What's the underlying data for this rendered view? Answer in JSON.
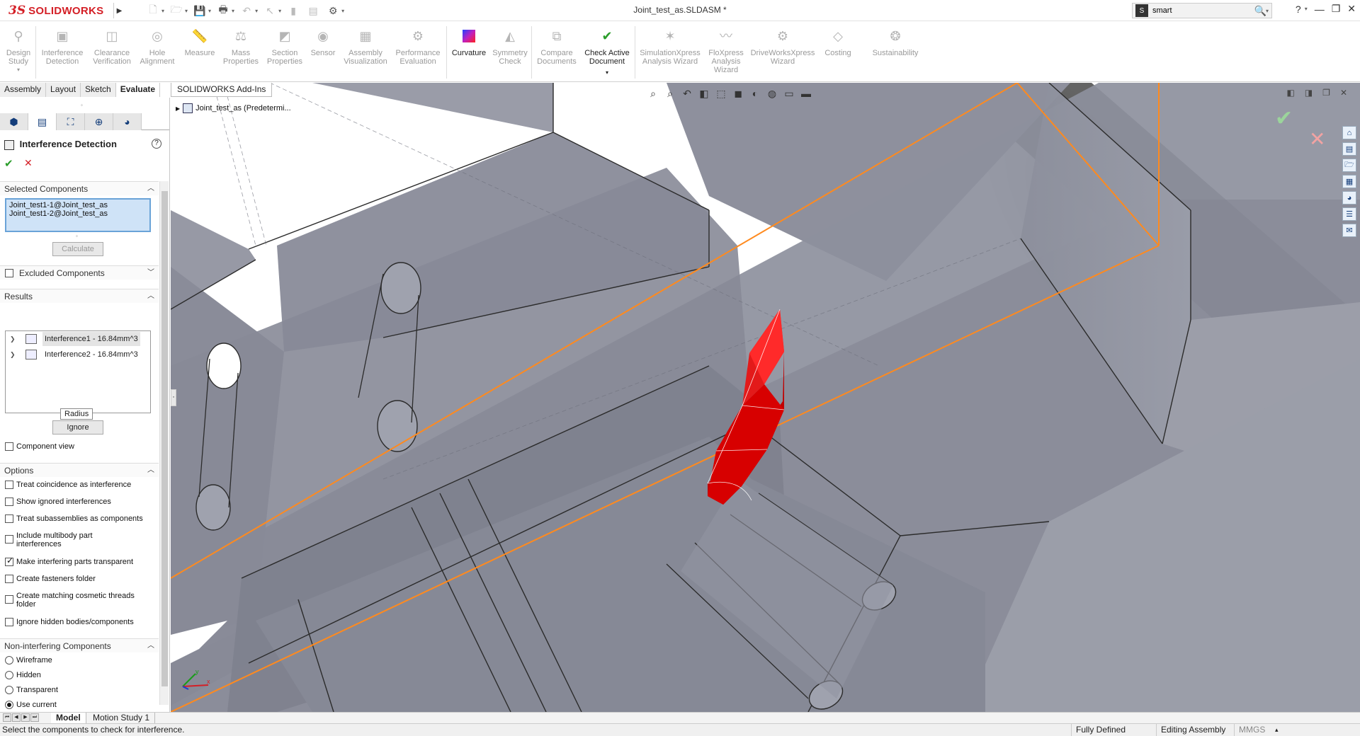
{
  "app": {
    "logo_prefix": "3S",
    "logo_text": "SOLIDWORKS",
    "document_title": "Joint_test_as.SLDASM *"
  },
  "search": {
    "value": "smart",
    "placeholder": ""
  },
  "command_manager": {
    "items": [
      {
        "label": "Design Study",
        "icon": "design-study-icon",
        "enabled": false
      },
      {
        "label": "Interference Detection",
        "icon": "interference-detection-icon",
        "enabled": false
      },
      {
        "label": "Clearance Verification",
        "icon": "clearance-verification-icon",
        "enabled": false
      },
      {
        "label": "Hole Alignment",
        "icon": "hole-alignment-icon",
        "enabled": false
      },
      {
        "label": "Measure",
        "icon": "measure-icon",
        "enabled": false
      },
      {
        "label": "Mass Properties",
        "icon": "mass-properties-icon",
        "enabled": false
      },
      {
        "label": "Section Properties",
        "icon": "section-properties-icon",
        "enabled": false
      },
      {
        "label": "Sensor",
        "icon": "sensor-icon",
        "enabled": false
      },
      {
        "label": "Assembly Visualization",
        "icon": "assembly-visualization-icon",
        "enabled": false
      },
      {
        "label": "Performance Evaluation",
        "icon": "performance-evaluation-icon",
        "enabled": false
      },
      {
        "label": "Curvature",
        "icon": "curvature-icon",
        "enabled": true
      },
      {
        "label": "Symmetry Check",
        "icon": "symmetry-check-icon",
        "enabled": false
      },
      {
        "label": "Compare Documents",
        "icon": "compare-documents-icon",
        "enabled": false
      },
      {
        "label": "Check Active Document",
        "icon": "check-active-document-icon",
        "enabled": true
      },
      {
        "label": "SimulationXpress Analysis Wizard",
        "icon": "simulationxpress-icon",
        "enabled": false
      },
      {
        "label": "FloXpress Analysis Wizard",
        "icon": "floxpress-icon",
        "enabled": false
      },
      {
        "label": "DriveWorksXpress Wizard",
        "icon": "driveworksxpress-icon",
        "enabled": false
      },
      {
        "label": "Costing",
        "icon": "costing-icon",
        "enabled": false
      },
      {
        "label": "Sustainability",
        "icon": "sustainability-icon",
        "enabled": false
      }
    ],
    "tabs": [
      "Assembly",
      "Layout",
      "Sketch",
      "Evaluate",
      "SOLIDWORKS Add-Ins"
    ],
    "active_tab": "Evaluate"
  },
  "property_manager": {
    "title": "Interference Detection",
    "selected_components": {
      "header": "Selected Components",
      "items": [
        "Joint_test1-1@Joint_test_as",
        "Joint_test1-2@Joint_test_as"
      ],
      "calculate_label": "Calculate"
    },
    "excluded_components": {
      "header": "Excluded Components",
      "checked": false
    },
    "results": {
      "header": "Results",
      "items": [
        "Interference1 - 16.84mm^3",
        "Interference2 - 16.84mm^3"
      ],
      "tooltip": "Radius",
      "ignore_label": "Ignore",
      "component_view_label": "Component view",
      "component_view_checked": false
    },
    "options": {
      "header": "Options",
      "items": [
        {
          "label": "Treat coincidence as interference",
          "checked": false
        },
        {
          "label": "Show ignored interferences",
          "checked": false
        },
        {
          "label": "Treat subassemblies as components",
          "checked": false
        },
        {
          "label": "Include multibody part interferences",
          "checked": false
        },
        {
          "label": "Make interfering parts transparent",
          "checked": true
        },
        {
          "label": "Create fasteners folder",
          "checked": false
        },
        {
          "label": "Create matching cosmetic threads folder",
          "checked": false
        },
        {
          "label": "Ignore hidden bodies/components",
          "checked": false
        }
      ]
    },
    "non_interfering": {
      "header": "Non-interfering Components",
      "items": [
        {
          "label": "Wireframe",
          "selected": false
        },
        {
          "label": "Hidden",
          "selected": false
        },
        {
          "label": "Transparent",
          "selected": false
        },
        {
          "label": "Use current",
          "selected": true
        }
      ]
    }
  },
  "viewport": {
    "breadcrumb_tab": "SOLIDWORKS Add-Ins",
    "tree_root": "Joint_test_as  (Predetermi...",
    "interference_color": "#d40000",
    "edge_color": "#ff8a1e"
  },
  "bottom_tabs": [
    "Model",
    "Motion Study 1"
  ],
  "status": {
    "message": "Select the components to check for interference.",
    "definition": "Fully Defined",
    "mode": "Editing Assembly",
    "units": "MMGS"
  }
}
